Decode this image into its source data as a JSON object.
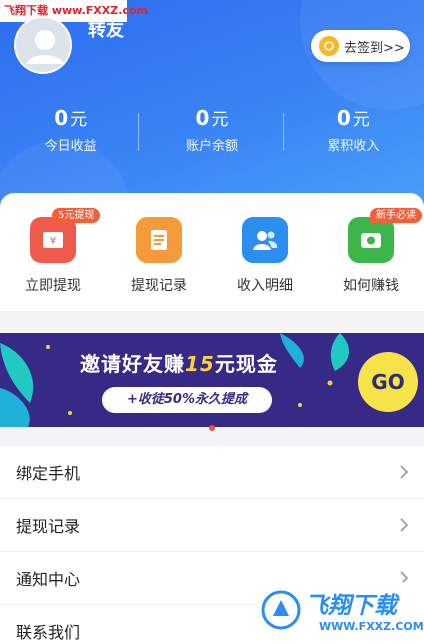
{
  "watermark_top": "飞翔下载 www.FXXZ.com",
  "profile": {
    "name": "转友"
  },
  "signin": {
    "label": "去签到>>"
  },
  "stats": [
    {
      "value": "0",
      "unit": "元",
      "label": "今日收益"
    },
    {
      "value": "0",
      "unit": "元",
      "label": "账户余额"
    },
    {
      "value": "0",
      "unit": "元",
      "label": "累积收入"
    }
  ],
  "quick_menu": [
    {
      "label": "立即提现",
      "badge": "5元提现",
      "icon": "wallet-icon",
      "color": "#ef5a4c"
    },
    {
      "label": "提现记录",
      "badge": "",
      "icon": "document-icon",
      "color": "#f59a3a"
    },
    {
      "label": "收入明细",
      "badge": "",
      "icon": "user-group-icon",
      "color": "#2e8ef0"
    },
    {
      "label": "如何赚钱",
      "badge": "新手必读",
      "icon": "money-icon",
      "color": "#3cb54a"
    }
  ],
  "banner": {
    "title_pre": "邀请好友赚",
    "title_amount": "15",
    "title_post": "元现金",
    "subtitle": "+收徒50%永久提成",
    "go": "GO"
  },
  "menu": [
    {
      "label": "绑定手机"
    },
    {
      "label": "提现记录"
    },
    {
      "label": "通知中心"
    },
    {
      "label": "联系我们"
    }
  ],
  "watermark_bottom": {
    "title": "飞翔下载",
    "url": "WWW.FXXZ.COM"
  }
}
